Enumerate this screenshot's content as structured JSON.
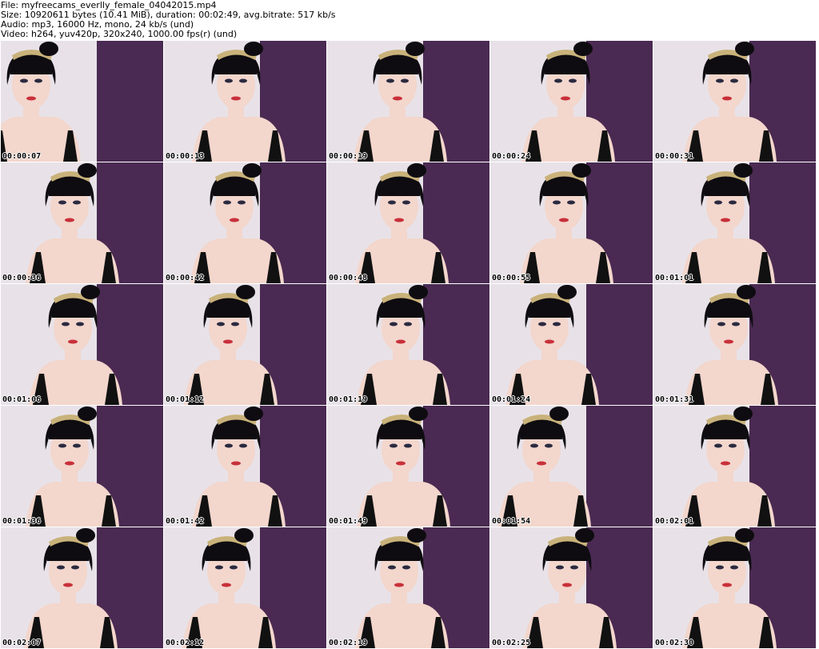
{
  "info": {
    "file": "File: myfreecams_everlly_female_04042015.mp4",
    "size": "Size: 10920611 bytes (10.41 MiB), duration: 00:02:49, avg.bitrate: 517 kb/s",
    "audio": "Audio: mp3, 16000 Hz, mono, 24 kb/s (und)",
    "video": "Video: h264, yuv420p, 320x240, 1000.00 fps(r) (und)"
  },
  "thumbnails": [
    "00:00:07",
    "00:00:13",
    "00:00:19",
    "00:00:24",
    "00:00:31",
    "00:00:36",
    "00:00:42",
    "00:00:48",
    "00:00:55",
    "00:01:01",
    "00:01:06",
    "00:01:12",
    "00:01:19",
    "00:01:24",
    "00:01:31",
    "00:01:36",
    "00:01:42",
    "00:01:49",
    "00:01:54",
    "00:02:01",
    "00:02:07",
    "00:02:12",
    "00:02:19",
    "00:02:25",
    "00:02:30"
  ],
  "colors": {
    "wall_light": "#e8e2e8",
    "wall_purple": "#4a2a52",
    "hair": "#0e0c10",
    "skin": "#f3d6cc",
    "headband": "#c9b27a",
    "lips": "#c8303a",
    "top": "#111111"
  }
}
